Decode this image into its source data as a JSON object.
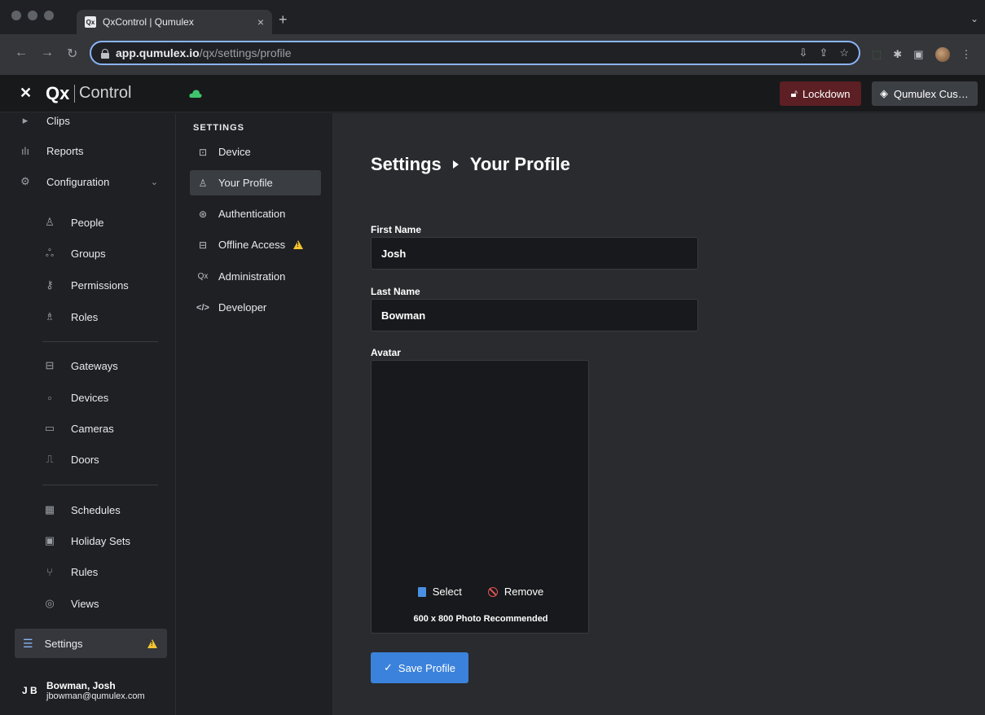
{
  "browser": {
    "tab_title": "QxControl | Qumulex",
    "tab_favicon": "Qx",
    "url_host": "app.qumulex.io",
    "url_path": "/qx/settings/profile"
  },
  "header": {
    "logo_qx": "Qx",
    "logo_control": "Control",
    "lockdown_label": "Lockdown",
    "customer_label": "Qumulex Cus…",
    "cloud_color": "#3ec46d",
    "lockdown_bg": "#5c1f24"
  },
  "sidebar": {
    "items": [
      {
        "label": "Clips",
        "icon": "play-icon"
      },
      {
        "label": "Reports",
        "icon": "bar-chart-icon"
      },
      {
        "label": "Configuration",
        "icon": "gear-icon"
      },
      {
        "label": "People",
        "icon": "person-icon"
      },
      {
        "label": "Groups",
        "icon": "group-icon"
      },
      {
        "label": "Permissions",
        "icon": "key-icon"
      },
      {
        "label": "Roles",
        "icon": "role-icon"
      },
      {
        "label": "Gateways",
        "icon": "gateway-icon"
      },
      {
        "label": "Devices",
        "icon": "device-icon"
      },
      {
        "label": "Cameras",
        "icon": "camera-icon"
      },
      {
        "label": "Doors",
        "icon": "door-icon"
      },
      {
        "label": "Schedules",
        "icon": "calendar-icon"
      },
      {
        "label": "Holiday Sets",
        "icon": "holiday-calendar-icon"
      },
      {
        "label": "Rules",
        "icon": "branch-icon"
      },
      {
        "label": "Views",
        "icon": "eye-icon"
      }
    ],
    "settings_label": "Settings",
    "user": {
      "initials": "J B",
      "name": "Bowman, Josh",
      "email": "jbowman@qumulex.com"
    }
  },
  "subnav": {
    "title": "SETTINGS",
    "items": [
      {
        "label": "Device",
        "icon": "device-icon"
      },
      {
        "label": "Your Profile",
        "icon": "person-icon"
      },
      {
        "label": "Authentication",
        "icon": "fingerprint-icon"
      },
      {
        "label": "Offline Access",
        "icon": "storage-icon"
      },
      {
        "label": "Administration",
        "icon": "qx-icon"
      },
      {
        "label": "Developer",
        "icon": "code-icon"
      }
    ],
    "icon_glyphs": {
      "administration": "Qx",
      "developer": "</>"
    }
  },
  "main": {
    "breadcrumb_root": "Settings",
    "breadcrumb_current": "Your Profile",
    "first_name_label": "First Name",
    "first_name_value": "Josh",
    "last_name_label": "Last Name",
    "last_name_value": "Bowman",
    "avatar_label": "Avatar",
    "select_label": "Select",
    "remove_label": "Remove",
    "avatar_hint": "600 x 800 Photo Recommended",
    "save_label": "Save Profile",
    "accent_color": "#3b82dc"
  }
}
